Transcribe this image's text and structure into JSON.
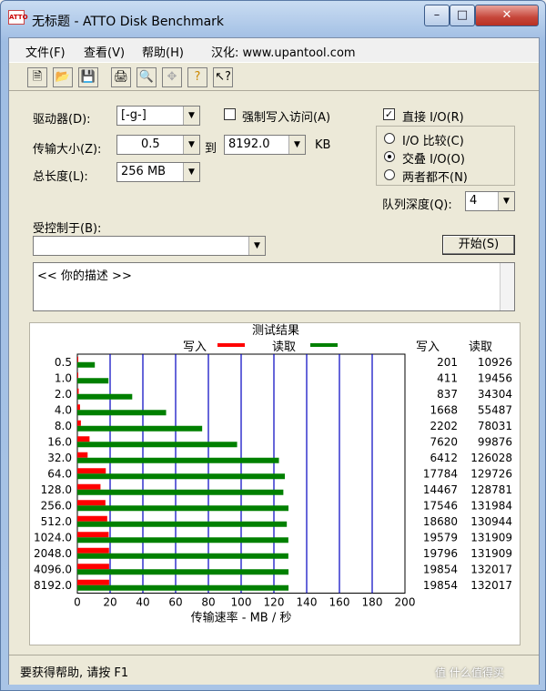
{
  "window": {
    "title": "无标题 - ATTO Disk Benchmark",
    "icon_text": "ATTO"
  },
  "menu": [
    "文件(F)",
    "查看(V)",
    "帮助(H)",
    "汉化: www.upantool.com"
  ],
  "toolbar": {
    "icons": [
      "new-icon",
      "open-icon",
      "save-icon",
      "print-icon",
      "print-preview-icon",
      "move-icon",
      "help-icon",
      "context-help-icon"
    ]
  },
  "form": {
    "drive_label": "驱动器(D):",
    "drive_value": "[-g-]",
    "force_write_label": "强制写入访问(A)",
    "direct_io_label": "直接 I/O(R)",
    "direct_io_checked": true,
    "transfer_label": "传输大小(Z):",
    "transfer_from": "0.5",
    "to_label": "到",
    "transfer_to": "8192.0",
    "kb_label": "KB",
    "total_label": "总长度(L):",
    "total_value": "256 MB",
    "radio_compare": "I/O 比较(C)",
    "radio_overlap": "交叠 I/O(O)",
    "radio_neither": "两者都不(N)",
    "queue_label": "队列深度(Q):",
    "queue_value": "4",
    "controlled_label": "受控制于(B):",
    "controlled_value": "",
    "start_button": "开始(S)",
    "description": "<< 你的描述 >>"
  },
  "status": {
    "text": "要获得帮助, 请按 F1"
  },
  "watermark": "值 什么值得买",
  "chart_data": {
    "type": "bar",
    "title": "测试结果",
    "legend": [
      {
        "name": "写入",
        "color": "#ff0000"
      },
      {
        "name": "读取",
        "color": "#008000"
      }
    ],
    "column_headers": [
      "写入",
      "读取"
    ],
    "categories": [
      "0.5",
      "1.0",
      "2.0",
      "4.0",
      "8.0",
      "16.0",
      "32.0",
      "64.0",
      "128.0",
      "256.0",
      "512.0",
      "1024.0",
      "2048.0",
      "4096.0",
      "8192.0"
    ],
    "series": [
      {
        "name": "写入",
        "values": [
          201,
          411,
          837,
          1668,
          2202,
          7620,
          6412,
          17784,
          14467,
          17546,
          18680,
          19579,
          19796,
          19854,
          19854
        ]
      },
      {
        "name": "读取",
        "values": [
          10926,
          19456,
          34304,
          55487,
          78031,
          99876,
          126028,
          129726,
          128781,
          131984,
          130944,
          131909,
          131909,
          132017,
          132017
        ]
      }
    ],
    "xlabel": "传输速率 - MB / 秒",
    "xticks": [
      0,
      20,
      40,
      60,
      80,
      100,
      120,
      140,
      160,
      180,
      200
    ],
    "xlim": [
      0,
      200
    ]
  }
}
